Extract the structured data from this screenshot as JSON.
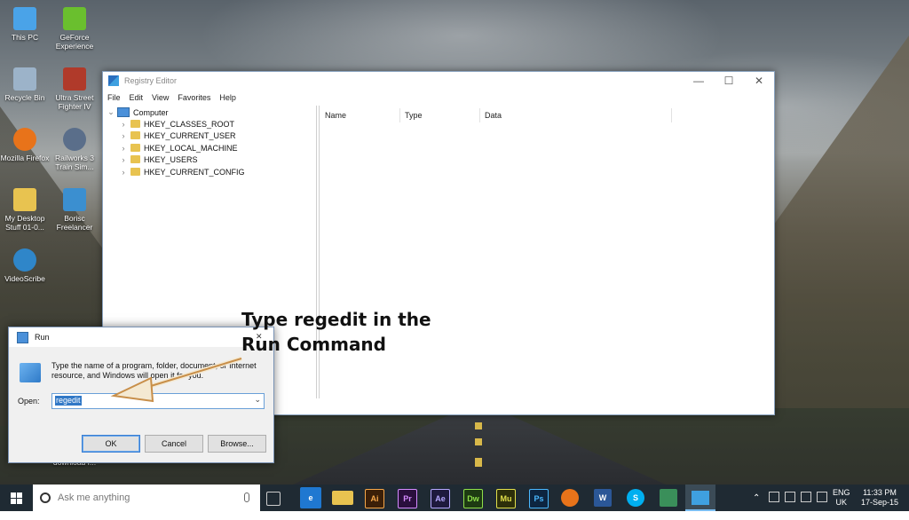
{
  "desktop": {
    "icons": [
      {
        "label": "This PC",
        "color": "#4aa3e8"
      },
      {
        "label": "GeForce Experience",
        "color": "#6abf2e"
      },
      {
        "label": "Recycle Bin",
        "color": "#9cb3c9"
      },
      {
        "label": "Ultra Street Fighter IV",
        "color": "#b03a2a"
      },
      {
        "label": "Mozilla Firefox",
        "color": "#e8731a"
      },
      {
        "label": "Railworks 3 Train Sim...",
        "color": "#5a6e8a"
      },
      {
        "label": "My Desktop Stuff 01-0...",
        "color": "#e8c350"
      },
      {
        "label": "Borisc Freelancer",
        "color": "#3b8fd0"
      },
      {
        "label": "VideoScribe",
        "color": "#2f86c9"
      },
      {
        "label": "download f...",
        "color": "#e8c350"
      }
    ]
  },
  "regedit": {
    "title": "Registry Editor",
    "menu": [
      "File",
      "Edit",
      "View",
      "Favorites",
      "Help"
    ],
    "tree_root": "Computer",
    "hives": [
      "HKEY_CLASSES_ROOT",
      "HKEY_CURRENT_USER",
      "HKEY_LOCAL_MACHINE",
      "HKEY_USERS",
      "HKEY_CURRENT_CONFIG"
    ],
    "columns": [
      "Name",
      "Type",
      "Data"
    ],
    "controls": {
      "minimize": "—",
      "maximize": "☐",
      "close": "✕"
    }
  },
  "run": {
    "title": "Run",
    "close": "✕",
    "description": "Type the name of a program, folder, document, or Internet resource, and Windows will open it for you.",
    "open_label": "Open:",
    "value": "regedit",
    "dropdown": "⌄",
    "ok": "OK",
    "cancel": "Cancel",
    "browse": "Browse..."
  },
  "annotation": {
    "line1": "Type regedit in the",
    "line2": "Run Command"
  },
  "taskbar": {
    "search_placeholder": "Ask me anything",
    "apps": [
      {
        "name": "task-view",
        "label": "",
        "color": "#1f2a33"
      },
      {
        "name": "edge",
        "label": "e",
        "color": "#1f78d1"
      },
      {
        "name": "file-explorer",
        "label": "",
        "color": "#e8c350"
      },
      {
        "name": "illustrator",
        "label": "Ai",
        "color": "#3b1f08"
      },
      {
        "name": "premiere",
        "label": "Pr",
        "color": "#2a0f3d"
      },
      {
        "name": "after-effects",
        "label": "Ae",
        "color": "#1e1a3d"
      },
      {
        "name": "dreamweaver",
        "label": "Dw",
        "color": "#1d3a12"
      },
      {
        "name": "muse",
        "label": "Mu",
        "color": "#2d2f0a"
      },
      {
        "name": "photoshop",
        "label": "Ps",
        "color": "#0d2540"
      },
      {
        "name": "firefox",
        "label": "",
        "color": "#e8731a"
      },
      {
        "name": "word",
        "label": "W",
        "color": "#2b5797"
      },
      {
        "name": "skype",
        "label": "S",
        "color": "#00aff0"
      },
      {
        "name": "app-green",
        "label": "",
        "color": "#3a8f5a"
      },
      {
        "name": "registry-editor",
        "label": "",
        "color": "#3fa0e0"
      }
    ],
    "language": "ENG",
    "region": "UK",
    "time": "11:33 PM",
    "date": "17-Sep-15"
  }
}
